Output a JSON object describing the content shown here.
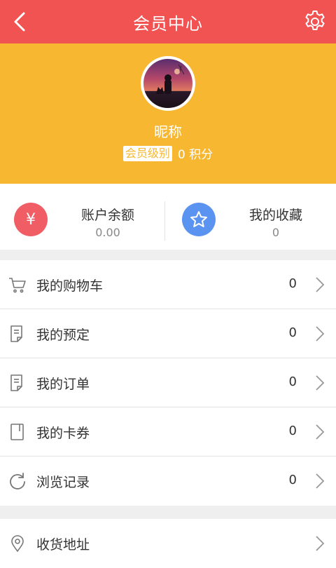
{
  "header": {
    "title": "会员中心"
  },
  "profile": {
    "nickname": "昵称",
    "level_badge": "会员级别",
    "points": "0 积分"
  },
  "stats": [
    {
      "label": "账户余额",
      "value": "0.00",
      "icon_text": "¥",
      "color": "#f15d64"
    },
    {
      "label": "我的收藏",
      "value": "0",
      "color": "#5b93f0"
    }
  ],
  "menu": [
    {
      "label": "我的购物车",
      "count": "0",
      "icon": "cart-icon"
    },
    {
      "label": "我的预定",
      "count": "0",
      "icon": "document-icon"
    },
    {
      "label": "我的订单",
      "count": "0",
      "icon": "document-icon"
    },
    {
      "label": "我的卡券",
      "count": "0",
      "icon": "card-icon"
    },
    {
      "label": "浏览记录",
      "count": "0",
      "icon": "refresh-icon"
    }
  ],
  "menu2": [
    {
      "label": "收货地址",
      "icon": "location-pin-icon"
    }
  ],
  "colors": {
    "header": "#f15353",
    "profile_bg": "#f7b731",
    "background": "#efefef"
  }
}
